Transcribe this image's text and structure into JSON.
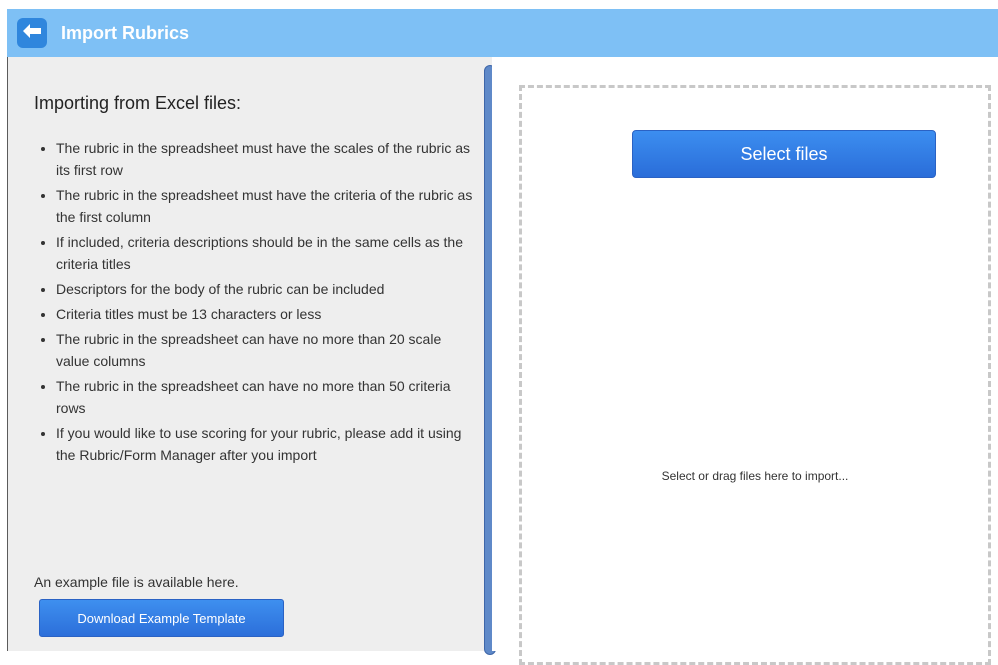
{
  "header": {
    "title": "Import Rubrics",
    "back_icon": "arrow-left-icon"
  },
  "left": {
    "title": "Importing from Excel files:",
    "rules": [
      "The rubric in the spreadsheet must have the scales of the rubric as its first row",
      "The rubric in the spreadsheet must have the criteria of the rubric as the first column",
      "If included, criteria descriptions should be in the same cells as the criteria titles",
      "Descriptors for the body of the rubric can be included",
      "Criteria titles must be 13 characters or less",
      "The rubric in the spreadsheet can have no more than 20 scale value columns",
      "The rubric in the spreadsheet can have no more than 50 criteria rows",
      "If you would like to use scoring for your rubric, please add it using the Rubric/Form Manager after you import"
    ],
    "example_text": "An example file is available here.",
    "download_label": "Download Example Template"
  },
  "right": {
    "select_label": "Select files",
    "drop_hint": "Select or drag files here to import..."
  },
  "colors": {
    "header_bg": "#7ec0f5",
    "button_blue": "#2f7ee6",
    "panel_bg": "#eeeeee"
  }
}
